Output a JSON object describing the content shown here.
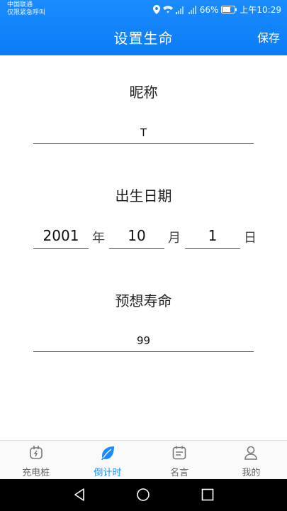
{
  "status_bar": {
    "carrier_line1": "中国联通",
    "carrier_line2": "仅限紧急呼叫",
    "battery": "66%",
    "time": "上午10:29"
  },
  "header": {
    "title": "设置生命",
    "save_label": "保存",
    "background": "#1a8cff"
  },
  "form": {
    "nickname_label": "昵称",
    "nickname_value": "T",
    "birth_label": "出生日期",
    "birth_year": "2001",
    "year_unit": "年",
    "birth_month": "10",
    "month_unit": "月",
    "birth_day": "1",
    "day_unit": "日",
    "lifespan_label": "预想寿命",
    "lifespan_value": "99"
  },
  "tabs": [
    {
      "label": "充电桩",
      "icon": "charging-plug-icon"
    },
    {
      "label": "倒计时",
      "icon": "leaf-icon",
      "active": true
    },
    {
      "label": "名言",
      "icon": "calendar-note-icon"
    },
    {
      "label": "我的",
      "icon": "person-icon"
    }
  ],
  "accent_color": "#1a8cff"
}
